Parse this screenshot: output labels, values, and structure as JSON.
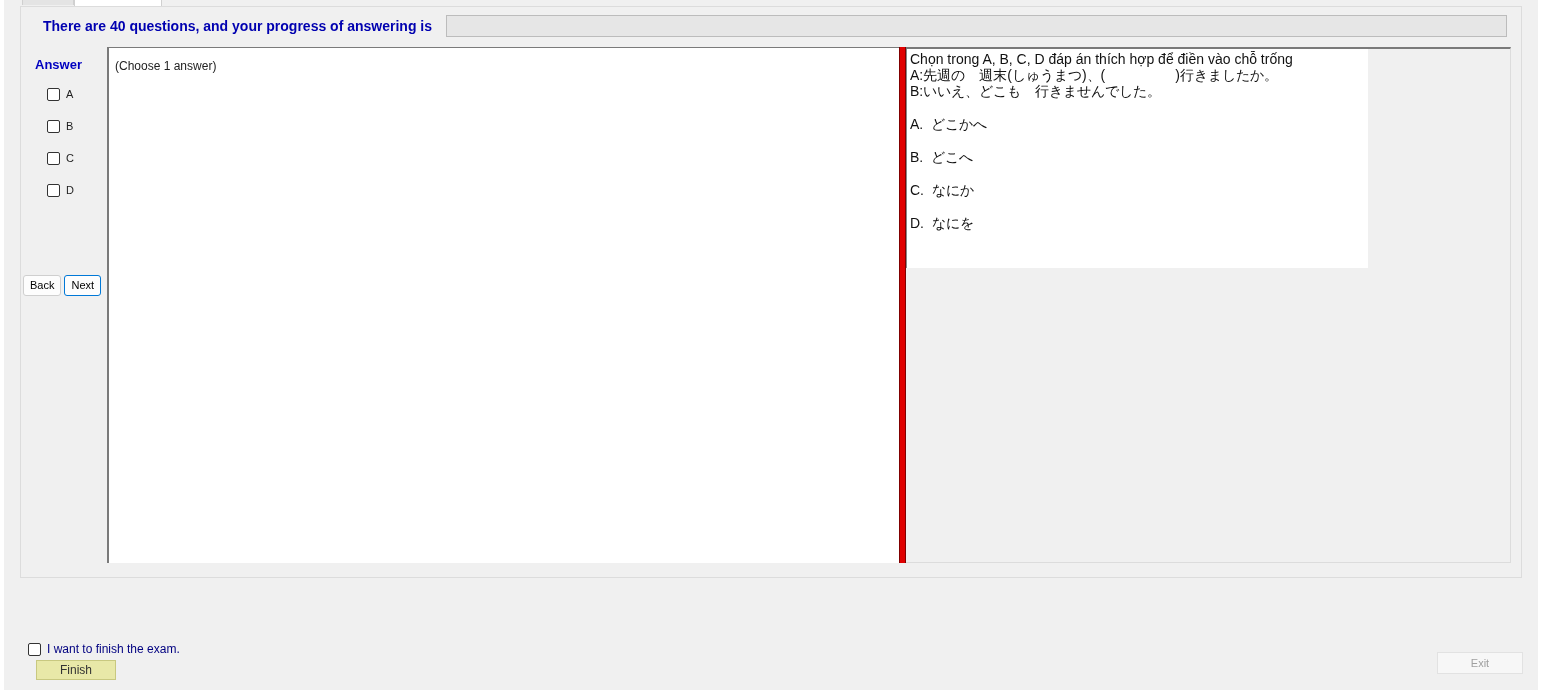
{
  "tabs": [
    {
      "selected": false
    },
    {
      "selected": true
    }
  ],
  "header": {
    "text": "There are 40 questions, and your progress of answering is",
    "progress": {
      "level": 0
    }
  },
  "answer": {
    "title": "Answer",
    "options": [
      {
        "label": "A",
        "checked": false
      },
      {
        "label": "B",
        "checked": false
      },
      {
        "label": "C",
        "checked": false
      },
      {
        "label": "D",
        "checked": false
      }
    ]
  },
  "navigation": [
    {
      "label": "Back",
      "selected": false
    },
    {
      "label": "Next",
      "selected": true
    }
  ],
  "answer_area": {
    "text": "(Choose 1 answer)"
  },
  "question": {
    "lines": [
      "Chọn trong A, B, C, D đáp án thích hợp để điền vào chỗ trống",
      "A:先週の　週末(しゅうまつ)、(　　　　　)行きましたか。",
      "B:いいえ、どこも　行きませんでした。"
    ],
    "choices": [
      "A.  どこかへ",
      "B.  どこへ",
      "C.  なにか",
      "D.  なにを"
    ]
  },
  "finish": {
    "confirm": {
      "label": "I want to finish the exam.",
      "checked": false
    },
    "button": {
      "label": "Finish",
      "disabled": false
    }
  },
  "exit": {
    "label": "Exit",
    "disabled": true
  }
}
